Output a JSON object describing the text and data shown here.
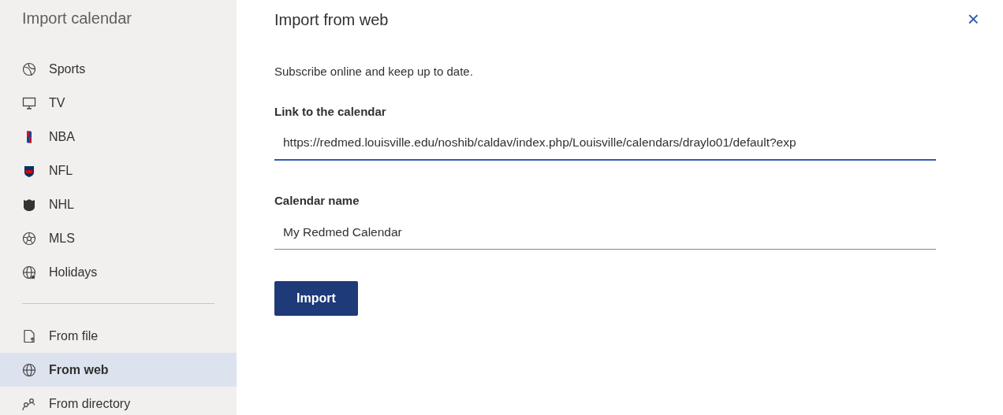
{
  "sidebar": {
    "title": "Import calendar",
    "items": [
      {
        "label": "Sports",
        "selected": false
      },
      {
        "label": "TV",
        "selected": false
      },
      {
        "label": "NBA",
        "selected": false
      },
      {
        "label": "NFL",
        "selected": false
      },
      {
        "label": "NHL",
        "selected": false
      },
      {
        "label": "MLS",
        "selected": false
      },
      {
        "label": "Holidays",
        "selected": false
      }
    ],
    "sources": [
      {
        "label": "From file",
        "selected": false
      },
      {
        "label": "From web",
        "selected": true
      },
      {
        "label": "From directory",
        "selected": false
      }
    ]
  },
  "panel": {
    "title": "Import from web",
    "subtitle": "Subscribe online and keep up to date.",
    "fields": [
      {
        "label": "Link to the calendar",
        "value": "https://redmed.louisville.edu/noshib/caldav/index.php/Louisville/calendars/draylo01/default?exp",
        "focused": true
      },
      {
        "label": "Calendar name",
        "value": "My Redmed Calendar",
        "focused": false
      }
    ],
    "button": "Import",
    "close": "×"
  }
}
